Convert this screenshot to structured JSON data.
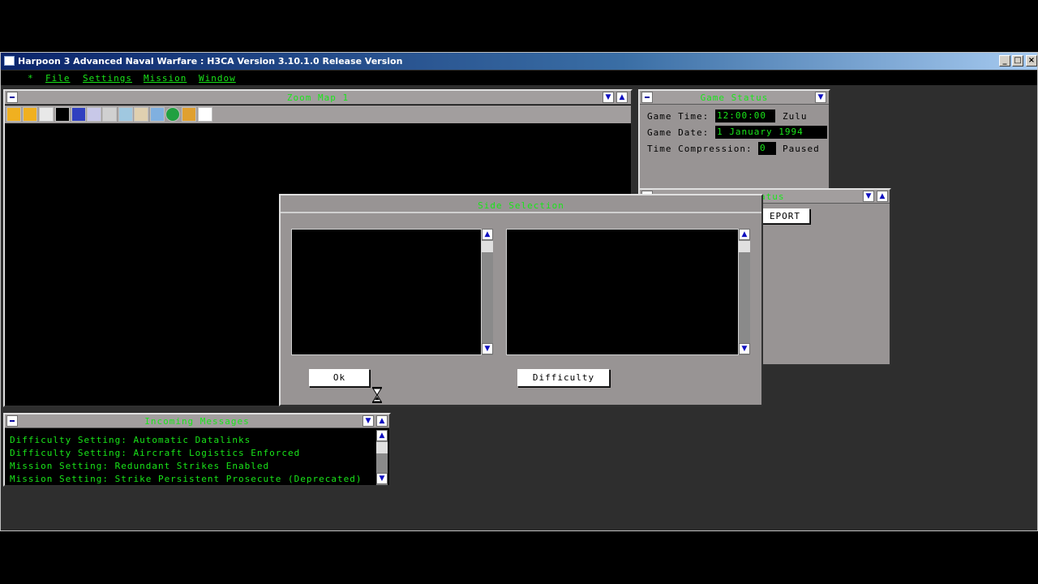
{
  "app": {
    "title": "Harpoon 3 Advanced Naval Warfare : H3CA Version 3.10.1.0 Release Version",
    "controls": {
      "minimize": "_",
      "maximize": "□",
      "close": "×"
    }
  },
  "menu": {
    "star": "*",
    "items": [
      "File",
      "Settings",
      "Mission",
      "Window"
    ]
  },
  "zoom_map": {
    "title": "Zoom Map 1",
    "toolbar_icons": [
      "zoom-in-icon",
      "zoom-out-icon",
      "zoom-fit-icon",
      "map-filter-icon",
      "grid-icon",
      "unit-edit-icon",
      "group-icon",
      "formation-icon",
      "waypoint-icon",
      "aircraft-icon",
      "target-icon",
      "range-rings-icon",
      "navigation-icon"
    ]
  },
  "game_status": {
    "title": "Game Status",
    "time_label": "Game Time:",
    "time_value": "12:00:00",
    "time_zone": "Zulu",
    "date_label": "Game Date:",
    "date_value": "1 January 1994",
    "compression_label": "Time Compression:",
    "compression_value": "0",
    "compression_state": "Paused"
  },
  "status_panel": {
    "title_visible": "atus",
    "report_button": "EPORT"
  },
  "side_selection": {
    "title": "Side Selection",
    "ok_button": "Ok",
    "difficulty_button": "Difficulty"
  },
  "messages": {
    "title": "Incoming Messages",
    "lines": [
      "Difficulty Setting: Automatic Datalinks",
      "Difficulty Setting: Aircraft Logistics Enforced",
      "Mission Setting: Redundant Strikes Enabled",
      "Mission Setting: Strike Persistent Prosecute (Deprecated)"
    ]
  },
  "colors": {
    "accent_green": "#19e619",
    "panel_gray": "#989494",
    "title_blue": "#0a246a"
  }
}
